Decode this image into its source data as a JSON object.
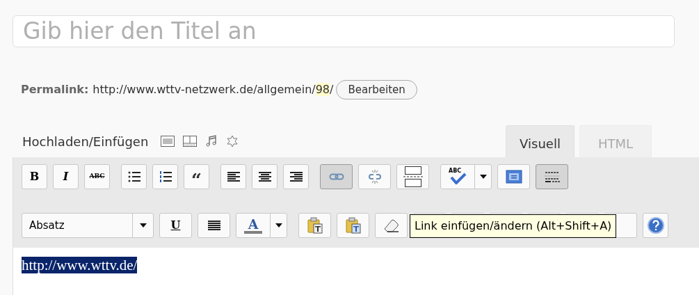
{
  "title_field": {
    "placeholder": "Gib hier den Titel an"
  },
  "permalink": {
    "label": "Permalink:",
    "url_start": "http://www.wttv-netzwerk.de/allgemein/",
    "slug": "98",
    "url_end": "/",
    "edit_button": "Bearbeiten"
  },
  "upload": {
    "label": "Hochladen/Einfügen",
    "icons": [
      {
        "kind": "image"
      },
      {
        "kind": "video"
      },
      {
        "kind": "audio"
      },
      {
        "kind": "media"
      }
    ]
  },
  "tabs": [
    {
      "label": "Visuell",
      "selected": true
    },
    {
      "label": "HTML",
      "selected": false
    }
  ],
  "toolbar_rows": [
    {
      "groups": [
        [
          {
            "kind": "bold",
            "label": "B",
            "pressed": false
          },
          {
            "kind": "italic",
            "label": "I",
            "pressed": false
          },
          {
            "kind": "strike",
            "label": "ABC",
            "pressed": false
          }
        ],
        [
          {
            "kind": "bullets",
            "pressed": false
          },
          {
            "kind": "numbers",
            "pressed": false
          },
          {
            "kind": "quote",
            "label": "“",
            "pressed": false
          }
        ],
        [
          {
            "kind": "align-left",
            "pressed": false
          },
          {
            "kind": "align-center",
            "pressed": false
          },
          {
            "kind": "align-right",
            "pressed": false
          }
        ],
        [
          {
            "kind": "link",
            "pressed": true
          },
          {
            "kind": "unlink",
            "pressed": false
          },
          {
            "kind": "more",
            "pressed": false
          }
        ],
        [
          {
            "kind": "spellcheck",
            "label": "ABC",
            "pressed": false
          },
          {
            "kind": "fullscreen",
            "pressed": false
          },
          {
            "kind": "kitchen-sink",
            "pressed": true
          }
        ]
      ]
    },
    {
      "groups": [
        [
          {
            "kind": "format-select",
            "label": "Absatz",
            "pressed": false
          },
          {
            "kind": "underline",
            "label": "U",
            "pressed": false
          },
          {
            "kind": "justify",
            "pressed": false
          },
          {
            "kind": "text-color",
            "label": "A",
            "pressed": false
          }
        ],
        [
          {
            "kind": "paste-text",
            "pressed": false
          },
          {
            "kind": "paste-word",
            "pressed": false
          },
          {
            "kind": "eraser",
            "pressed": false
          },
          {
            "kind": "blank",
            "pressed": false
          },
          {
            "kind": "blank",
            "pressed": false
          },
          {
            "kind": "blank",
            "pressed": false
          },
          {
            "kind": "blank",
            "pressed": false
          },
          {
            "kind": "blank",
            "pressed": false
          },
          {
            "kind": "blank",
            "pressed": false
          },
          {
            "kind": "help",
            "pressed": false
          }
        ]
      ]
    }
  ],
  "tooltip": {
    "text": "Link einfügen/ändern (Alt+Shift+A)"
  },
  "content": {
    "selected_text": "http://www.wttv.de/"
  }
}
